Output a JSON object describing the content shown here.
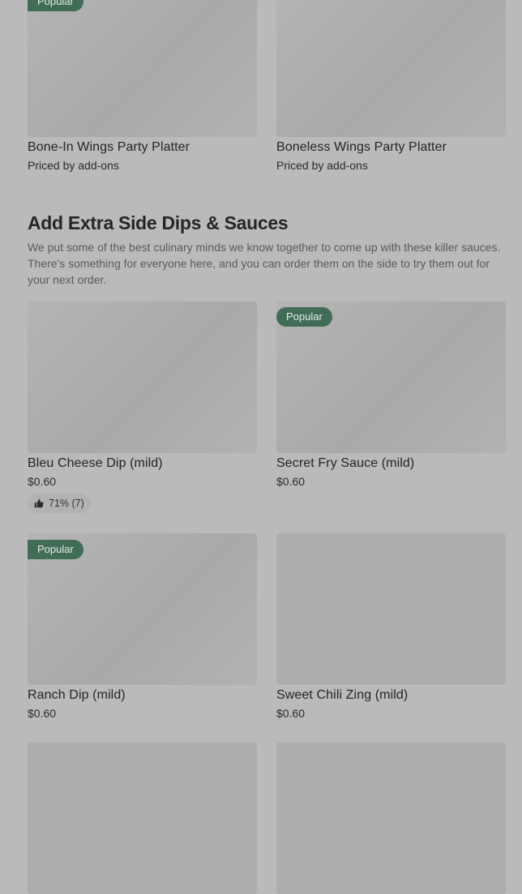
{
  "top_items": [
    {
      "name": "Bone-In Wings Party Platter",
      "price": "Priced by add-ons",
      "badge": "Popular"
    },
    {
      "name": "Boneless Wings Party Platter",
      "price": "Priced by add-ons"
    }
  ],
  "section": {
    "title": "Add Extra Side Dips & Sauces",
    "description": "We put some of the best culinary minds we know together to come up with these killer sauces. There's something for everyone here, and you can order them on the side to try them out for your next order."
  },
  "items": [
    {
      "name": "Bleu Cheese Dip (mild)",
      "price": "$0.60",
      "rating": "71% (7)",
      "rating_icon": "thumbs-up-icon"
    },
    {
      "name": "Secret Fry Sauce (mild)",
      "price": "$0.60",
      "badge": "Popular"
    },
    {
      "name": "Ranch Dip (mild)",
      "price": "$0.60",
      "badge": "Popular"
    },
    {
      "name": "Sweet Chili Zing (mild)",
      "price": "$0.60"
    }
  ],
  "colors": {
    "background": "#bababa",
    "badge": "#416c56",
    "image_placeholder": "#adadad"
  }
}
